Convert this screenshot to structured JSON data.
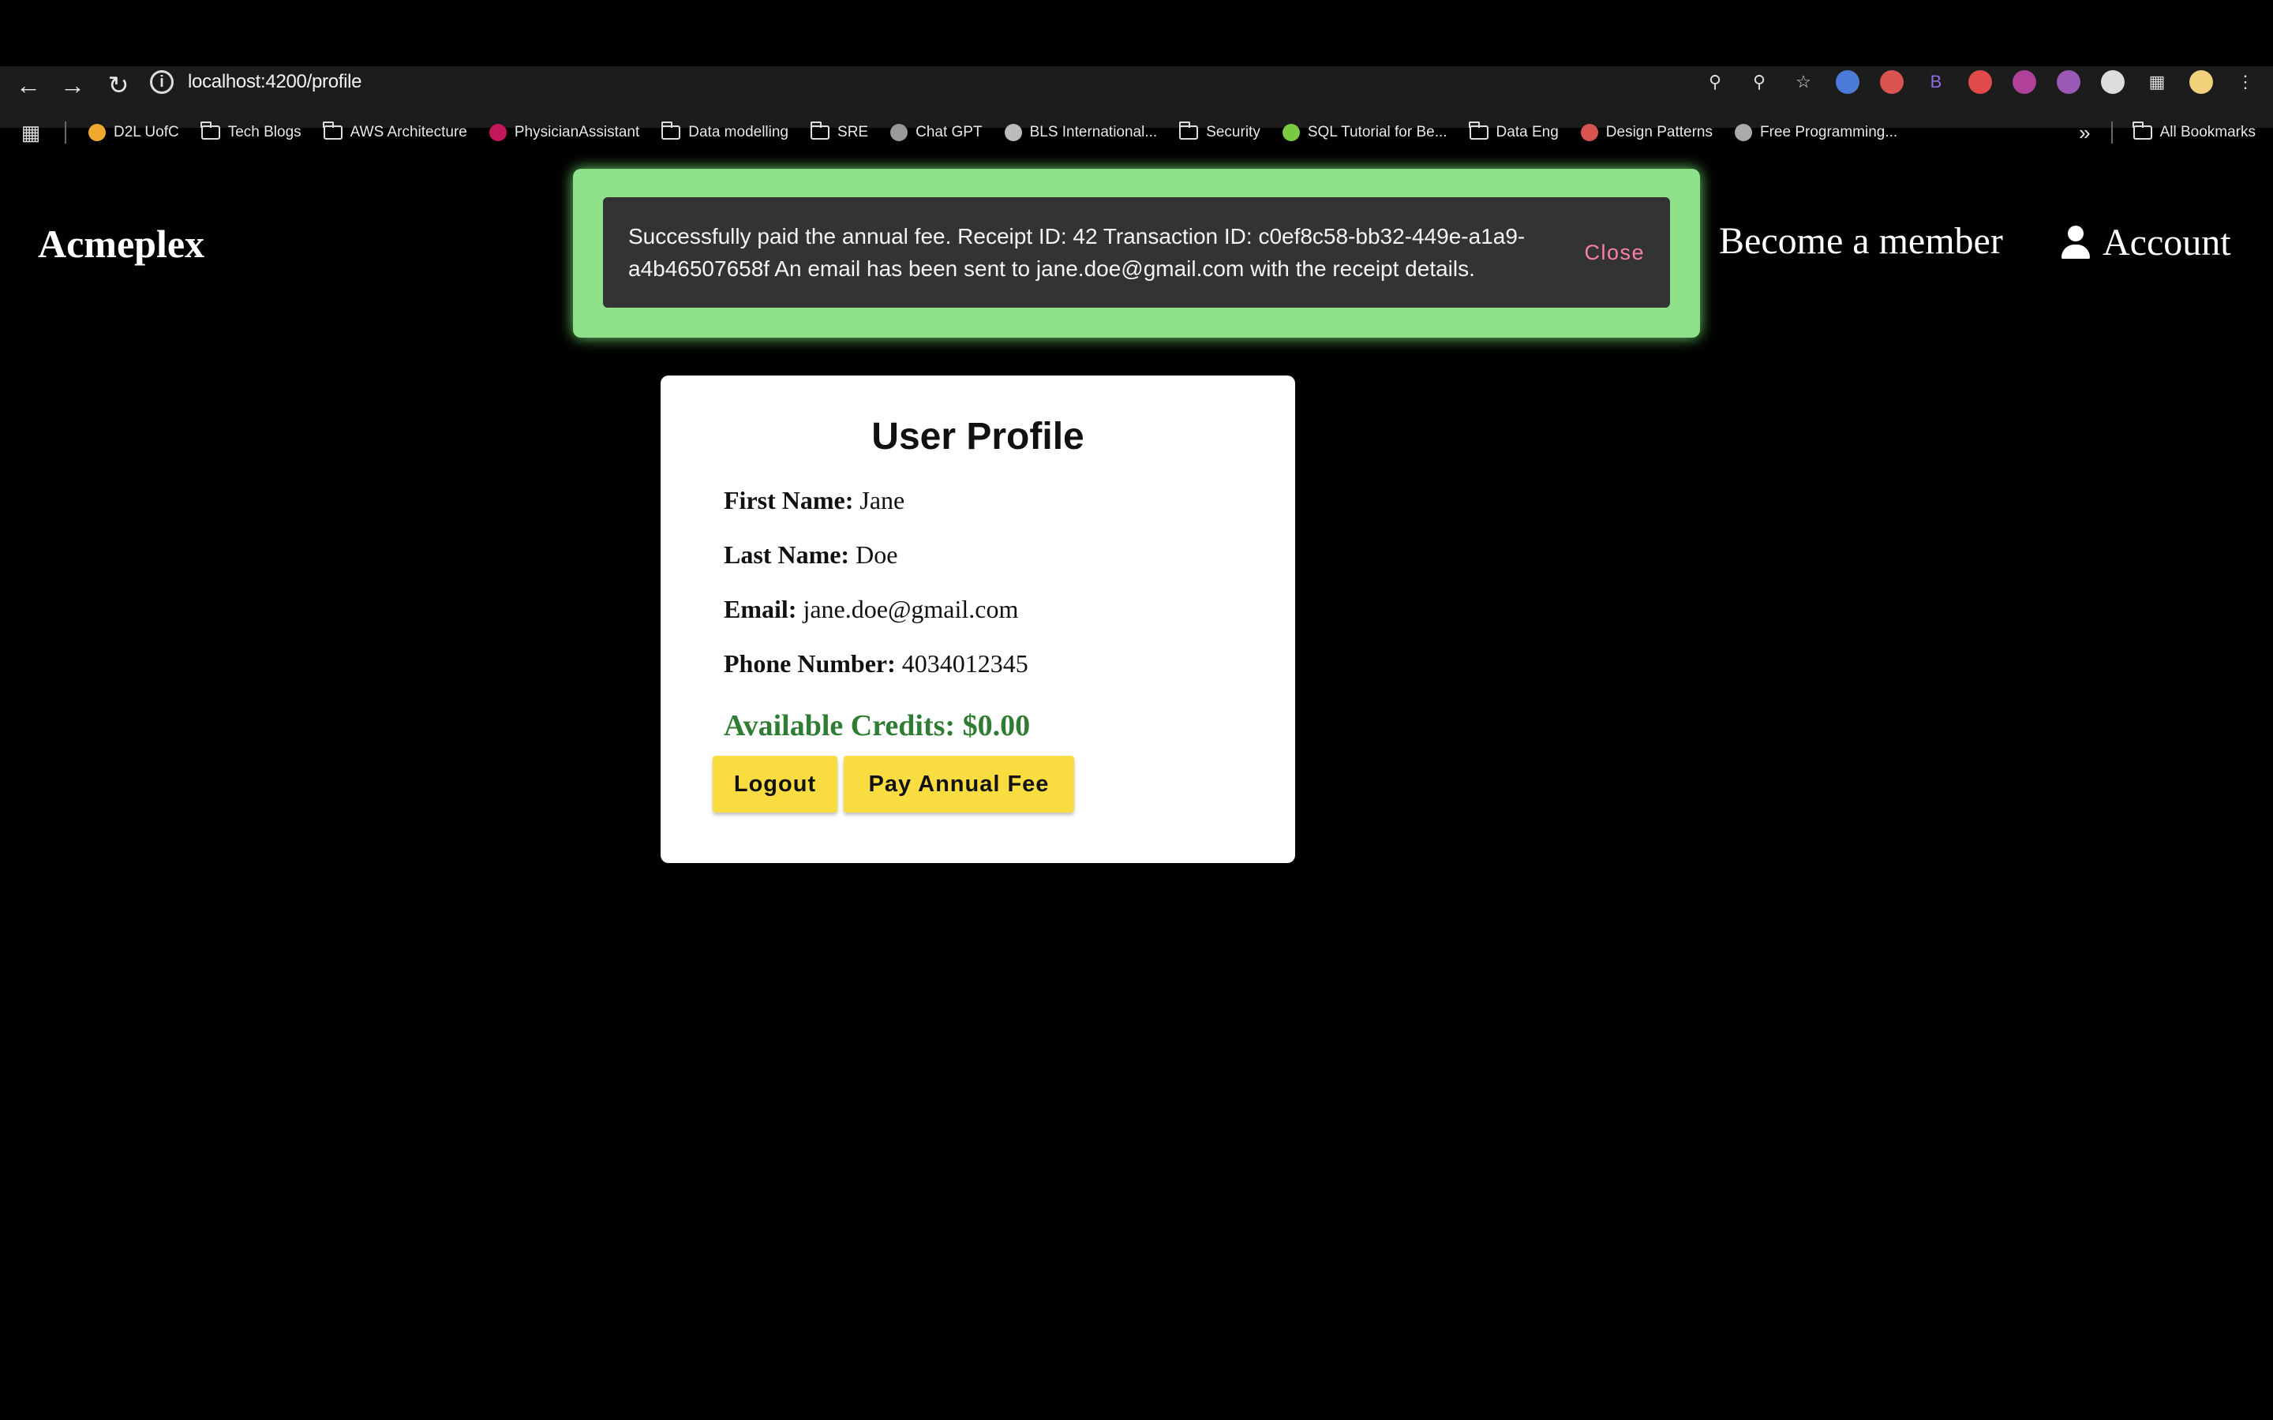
{
  "browser": {
    "url": "localhost:4200/profile",
    "bookmarks": [
      {
        "label": "D2L UofC",
        "icon": "d2l-icon"
      },
      {
        "label": "Tech Blogs",
        "icon": "folder-icon"
      },
      {
        "label": "AWS Architecture",
        "icon": "folder-icon"
      },
      {
        "label": "PhysicianAssistant",
        "icon": "angular-icon"
      },
      {
        "label": "Data modelling",
        "icon": "folder-icon"
      },
      {
        "label": "SRE",
        "icon": "folder-icon"
      },
      {
        "label": "Chat GPT",
        "icon": "openai-icon"
      },
      {
        "label": "BLS International...",
        "icon": "globe-icon"
      },
      {
        "label": "Security",
        "icon": "folder-icon"
      },
      {
        "label": "SQL Tutorial for Be...",
        "icon": "site-icon"
      },
      {
        "label": "Data Eng",
        "icon": "folder-icon"
      },
      {
        "label": "Design Patterns",
        "icon": "site-icon"
      },
      {
        "label": "Free Programming...",
        "icon": "site-icon"
      }
    ],
    "all_bookmarks": "All Bookmarks"
  },
  "header": {
    "brand": "Acmeplex",
    "become_member": "Become a member",
    "account": "Account"
  },
  "snackbar": {
    "message": "Successfully paid the annual fee. Receipt ID: 42 Transaction ID: c0ef8c58-bb32-449e-a1a9-a4b46507658f An email has been sent to jane.doe@gmail.com with the receipt details.",
    "close": "Close"
  },
  "profile": {
    "title": "User Profile",
    "first_name_label": "First Name:",
    "first_name": "Jane",
    "last_name_label": "Last Name:",
    "last_name": "Doe",
    "email_label": "Email:",
    "email": "jane.doe@gmail.com",
    "phone_label": "Phone Number:",
    "phone": "4034012345",
    "credits": "Available Credits: $0.00",
    "logout": "Logout",
    "pay_fee": "Pay Annual Fee"
  },
  "colors": {
    "snackbar_glow": "#8ee08a",
    "snackbar_bg": "#333333",
    "close_text": "#ff7fa8",
    "button_yellow": "#f9dc3f",
    "credits_green": "#2e7d32"
  }
}
